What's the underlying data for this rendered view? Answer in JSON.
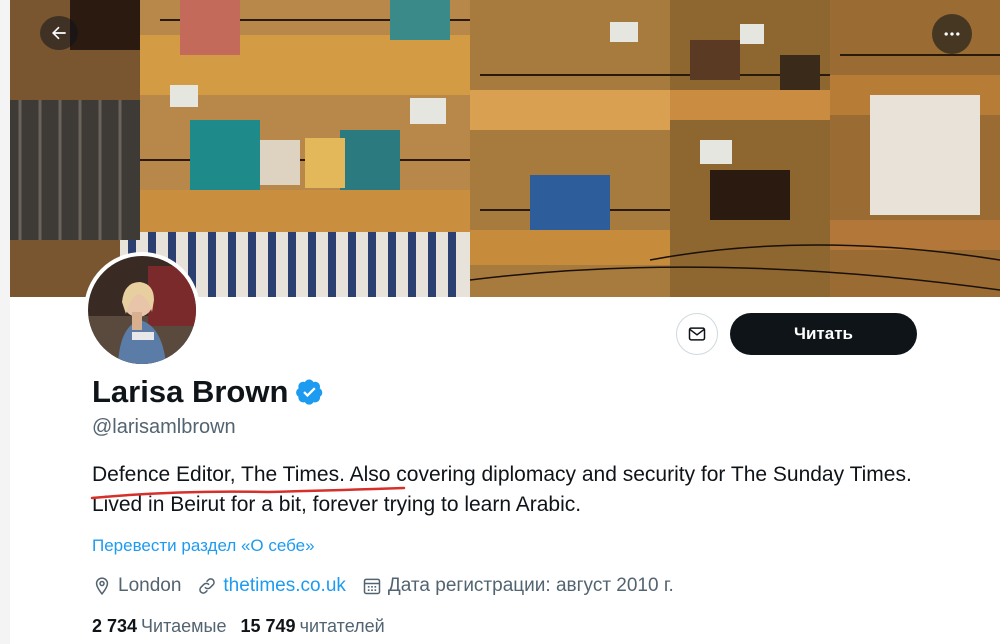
{
  "header": {
    "back_icon": "arrow-left-icon",
    "more_icon": "more-horizontal-icon"
  },
  "profile": {
    "name": "Larisa Brown",
    "verified_icon": "verified-badge-icon",
    "handle": "@larisamlbrown",
    "bio": "Defence Editor, The Times. Also covering diplomacy and security for The Sunday Times. Lived in Beirut for a bit, forever trying to learn Arabic.",
    "translate_label": "Перевести раздел «О себе»",
    "location": "London",
    "website": "thetimes.co.uk",
    "join_date": "Дата регистрации: август 2010 г.",
    "following_count": "2 734",
    "following_label": "Читаемые",
    "followers_count": "15 749",
    "followers_label": "читателей"
  },
  "actions": {
    "message_icon": "mail-icon",
    "follow_label": "Читать"
  },
  "colors": {
    "accent": "#1d9bf0",
    "follow_button": "#0f1419",
    "underline_annotation": "#d6302b"
  }
}
